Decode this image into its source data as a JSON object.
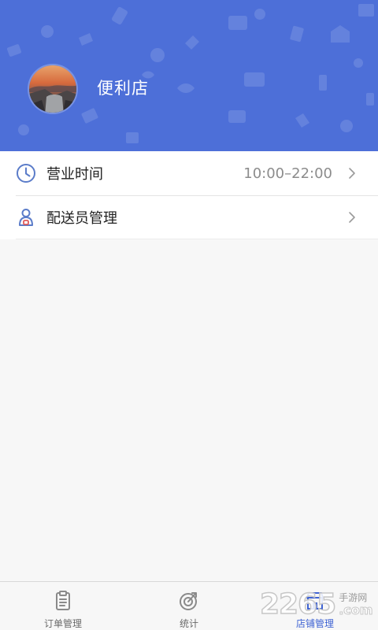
{
  "header": {
    "store_name": "便利店",
    "background": "#4d6fd8"
  },
  "menu": [
    {
      "label": "营业时间",
      "value": "10:00–22:00",
      "icon": "clock-icon"
    },
    {
      "label": "配送员管理",
      "value": "",
      "icon": "courier-icon"
    }
  ],
  "tabs": [
    {
      "label": "订单管理",
      "icon": "clipboard-icon",
      "active": false
    },
    {
      "label": "统计",
      "icon": "chart-dial-icon",
      "active": false
    },
    {
      "label": "店铺管理",
      "icon": "store-icon",
      "active": true
    }
  ],
  "watermark": {
    "number": "2265",
    "top": "手游网",
    "bottom": ".com"
  },
  "colors": {
    "accent": "#3f63d3",
    "icon_blue": "#5b7cc9",
    "icon_red": "#e05a5a"
  }
}
